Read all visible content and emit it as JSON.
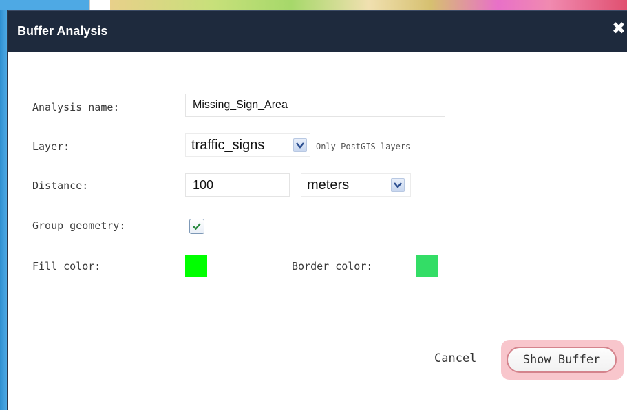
{
  "dialog": {
    "title": "Buffer Analysis",
    "close_glyph": "✖"
  },
  "form": {
    "analysis_name": {
      "label": "Analysis name:",
      "value": "Missing_Sign_Area"
    },
    "layer": {
      "label": "Layer:",
      "value": "traffic_signs",
      "hint": "Only PostGIS layers"
    },
    "distance": {
      "label": "Distance:",
      "value": "100",
      "unit": "meters"
    },
    "group_geometry": {
      "label": "Group geometry:",
      "checked": true
    },
    "fill_color": {
      "label": "Fill color:",
      "color": "#00ff00"
    },
    "border_color": {
      "label": "Border color:",
      "color": "#33dd66"
    }
  },
  "actions": {
    "cancel_label": "Cancel",
    "show_buffer_label": "Show Buffer"
  },
  "colors": {
    "titlebar": "#1e2a3d",
    "highlight": "#f8c6cc"
  }
}
